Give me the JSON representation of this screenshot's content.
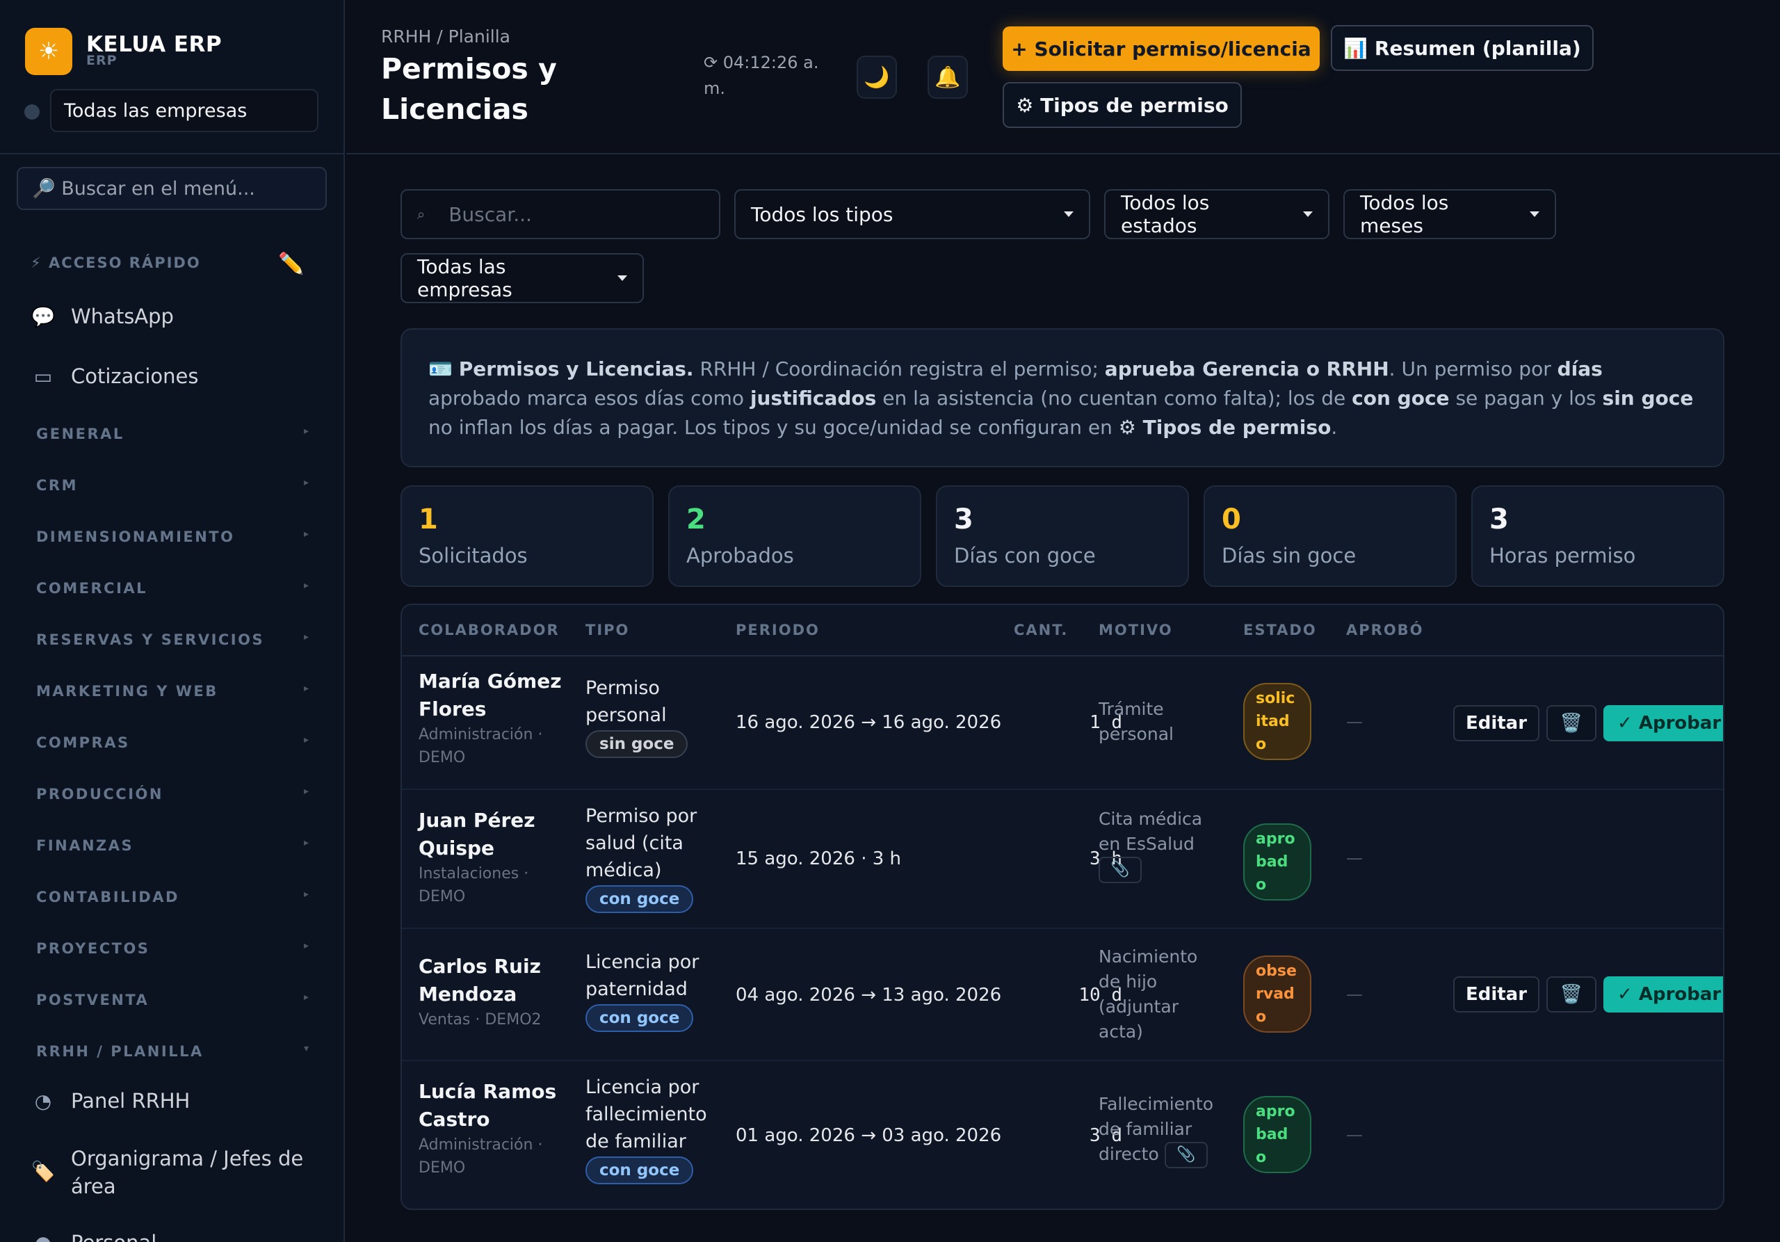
{
  "brand": {
    "name": "KELUA ERP",
    "sub": "ERP",
    "logo_icon": "☀"
  },
  "sidebar": {
    "company_select": "Todas las empresas",
    "search_placeholder": "🔎 Buscar en el menú...",
    "quick_access_title": "⚡ ACCESO RÁPIDO",
    "quick_edit_icon": "✏️",
    "quick_links": [
      {
        "icon": "💬",
        "label": "WhatsApp"
      },
      {
        "icon": "▭",
        "label": "Cotizaciones"
      }
    ],
    "sections": [
      "GENERAL",
      "CRM",
      "DIMENSIONAMIENTO",
      "COMERCIAL",
      "RESERVAS Y SERVICIOS",
      "MARKETING Y WEB",
      "COMPRAS",
      "PRODUCCIÓN",
      "FINANZAS",
      "CONTABILIDAD",
      "PROYECTOS",
      "POSTVENTA",
      "RRHH / PLANILLA"
    ],
    "section_chevron": "▸",
    "section_chevron_open": "▾",
    "rrhh_links": [
      {
        "icon": "◔",
        "label": "Panel RRHH"
      },
      {
        "icon": "🏷️",
        "label": "Organigrama / Jefes de área"
      },
      {
        "icon": "●",
        "label": "Personal"
      }
    ]
  },
  "header": {
    "breadcrumb": "RRHH / Planilla",
    "title": "Permisos y Licencias",
    "clock": "⟳ 04:12:26 a. m.",
    "theme_icon": "🌙",
    "bell_icon": "🔔",
    "primary_button": "+ Solicitar permiso/licencia",
    "summary_button": "📊 Resumen (planilla)",
    "types_button": "⚙ Tipos de permiso"
  },
  "filters": {
    "search_placeholder": "Buscar...",
    "search_icon": "⌕",
    "types": "Todos los tipos",
    "states": "Todos los estados",
    "months": "Todos los meses",
    "companies": "Todas las empresas"
  },
  "info": {
    "icon": "🪪",
    "title": "Permisos y Licencias.",
    "t1": " RRHH / Coordinación registra el permiso; ",
    "b1": "aprueba Gerencia o RRHH",
    "t2": ". Un permiso por ",
    "b2": "días",
    "t3": " aprobado marca esos días como ",
    "b3": "justificados",
    "t4": " en la asistencia (no cuentan como falta); los de ",
    "b4": "con goce",
    "t5": " se pagan y los ",
    "b5": "sin goce",
    "t6": " no inflan los días a pagar. Los tipos y su goce/unidad se configuran en ",
    "b6": "⚙ Tipos de permiso",
    "t7": "."
  },
  "stats": [
    {
      "value": "1",
      "label": "Solicitados",
      "color": "#fbbf24"
    },
    {
      "value": "2",
      "label": "Aprobados",
      "color": "#4ade80"
    },
    {
      "value": "3",
      "label": "Días con goce",
      "color": "#f3f4f6"
    },
    {
      "value": "0",
      "label": "Días sin goce",
      "color": "#fbbf24"
    },
    {
      "value": "3",
      "label": "Horas permiso",
      "color": "#f3f4f6"
    }
  ],
  "table": {
    "headers": [
      "COLABORADOR",
      "TIPO",
      "PERIODO",
      "CANT.",
      "MOTIVO",
      "ESTADO",
      "APROBÓ"
    ],
    "edit_label": "Editar",
    "delete_icon": "🗑️",
    "approve_label": "✓ Aprobar",
    "clip_icon": "📎",
    "rows": [
      {
        "name_1": "María Gómez",
        "name_2": "Flores",
        "dept_1": "Administración ·",
        "dept_2": "DEMO",
        "tipo_1": "Permiso",
        "tipo_2": "personal",
        "tipo_3": "",
        "goce": "sin goce",
        "periodo": "16 ago. 2026 → 16 ago. 2026",
        "cant": "1 d",
        "motivo_1": "Trámite",
        "motivo_2": "personal",
        "motivo_3": "",
        "motivo_4": "",
        "estado_1": "solic",
        "estado_2": "itad",
        "estado_3": "o",
        "aprobo": "—"
      },
      {
        "name_1": "Juan Pérez",
        "name_2": "Quispe",
        "dept_1": "Instalaciones ·",
        "dept_2": "DEMO",
        "tipo_1": "Permiso por",
        "tipo_2": "salud (cita",
        "tipo_3": "médica)",
        "goce": "con goce",
        "periodo": "15 ago. 2026 · 3 h",
        "cant": "3 h",
        "motivo_1": "Cita médica",
        "motivo_2": "en EsSalud",
        "motivo_3": "",
        "motivo_4": "",
        "estado_1": "apro",
        "estado_2": "bad",
        "estado_3": "o",
        "aprobo": "—"
      },
      {
        "name_1": "Carlos Ruiz",
        "name_2": "Mendoza",
        "dept_1": "Ventas · DEMO2",
        "dept_2": "",
        "tipo_1": "Licencia por",
        "tipo_2": "paternidad",
        "tipo_3": "",
        "goce": "con goce",
        "periodo": "04 ago. 2026 → 13 ago. 2026",
        "cant": "10 d",
        "motivo_1": "Nacimiento",
        "motivo_2": "de hijo",
        "motivo_3": "(adjuntar",
        "motivo_4": "acta)",
        "estado_1": "obse",
        "estado_2": "rvad",
        "estado_3": "o",
        "aprobo": "—"
      },
      {
        "name_1": "Lucía Ramos",
        "name_2": "Castro",
        "dept_1": "Administración ·",
        "dept_2": "DEMO",
        "tipo_1": "Licencia por",
        "tipo_2": "fallecimiento",
        "tipo_3": "de familiar",
        "goce": "con goce",
        "periodo": "01 ago. 2026 → 03 ago. 2026",
        "cant": "3 d",
        "motivo_1": "Fallecimiento",
        "motivo_2": "de familiar",
        "motivo_3": "directo",
        "motivo_4": "",
        "estado_1": "apro",
        "estado_2": "bad",
        "estado_3": "o",
        "aprobo": "—"
      }
    ]
  }
}
